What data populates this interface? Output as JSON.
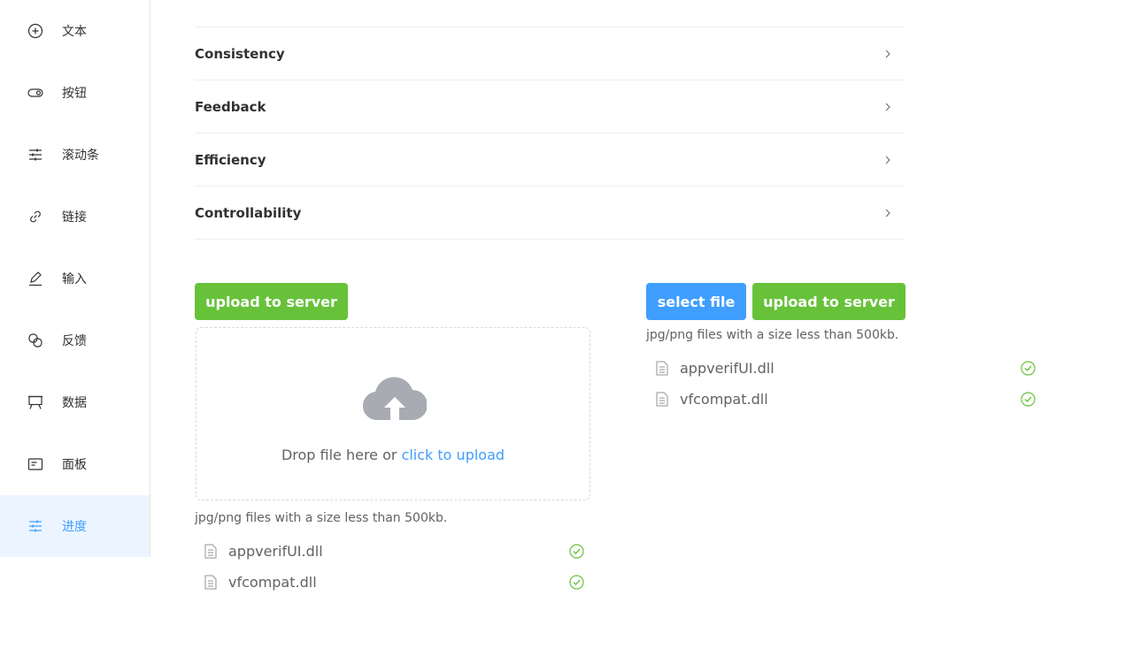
{
  "sidebar": {
    "items": [
      {
        "label": "文本",
        "icon": "plus-circle-icon"
      },
      {
        "label": "按钮",
        "icon": "toggle-icon"
      },
      {
        "label": "滚动条",
        "icon": "sliders-icon"
      },
      {
        "label": "链接",
        "icon": "link-icon"
      },
      {
        "label": "输入",
        "icon": "pen-icon"
      },
      {
        "label": "反馈",
        "icon": "overlap-icon"
      },
      {
        "label": "数据",
        "icon": "presentation-icon"
      },
      {
        "label": "面板",
        "icon": "card-icon"
      },
      {
        "label": "进度",
        "icon": "sliders-icon"
      }
    ],
    "active_index": 8
  },
  "collapse": {
    "items": [
      "Consistency",
      "Feedback",
      "Efficiency",
      "Controllability"
    ]
  },
  "left_upload": {
    "upload_button": "upload to server",
    "drop_text": "Drop file here or ",
    "drop_link": "click to upload",
    "tip": "jpg/png files with a size less than 500kb.",
    "files": [
      "appverifUI.dll",
      "vfcompat.dll"
    ]
  },
  "right_upload": {
    "select_button": "select file",
    "upload_button": "upload to server",
    "tip": "jpg/png files with a size less than 500kb.",
    "files": [
      "appverifUI.dll",
      "vfcompat.dll"
    ]
  },
  "colors": {
    "primary": "#409eff",
    "success": "#67c23a",
    "active_bg": "#ecf5ff"
  }
}
